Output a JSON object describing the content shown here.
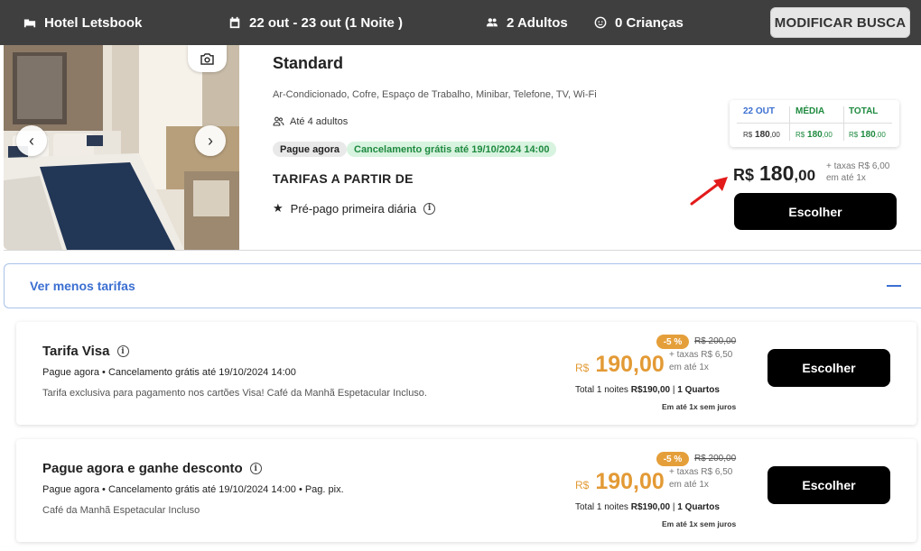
{
  "header": {
    "hotel_name": "Hotel Letsbook",
    "dates": "22 out - 23 out (1 Noite )",
    "adults": "2 Adultos",
    "children": "0 Crianças",
    "modify_button": "MODIFICAR BUSCA",
    "icons": {
      "hotel": "hotel-icon",
      "calendar": "calendar-icon",
      "adults": "people-icon",
      "children": "child-icon"
    }
  },
  "room": {
    "title": "Standard",
    "amenities": "Ar-Condicionado, Cofre, Espaço de Trabalho, Minibar, Telefone, TV, Wi-Fi",
    "capacity": "Até 4 adultos",
    "badge_payment": "Pague agora",
    "badge_cancel": "Cancelamento grátis até 19/10/2024 14:00",
    "rates_from": "TARIFAS A PARTIR DE",
    "prepaid_note": "Pré-pago primeira diária",
    "price_table": {
      "headers": [
        "22 OUT",
        "MÉDIA",
        "TOTAL"
      ],
      "values": [
        {
          "cur": "R$",
          "amount": "180",
          "dec": ",00"
        },
        {
          "cur": "R$",
          "amount": "180",
          "dec": ",00"
        },
        {
          "cur": "R$",
          "amount": "180",
          "dec": ",00"
        }
      ]
    },
    "price": {
      "currency": "R$",
      "integer": "180",
      "decimals": ",00"
    },
    "taxes": "+ taxas R$ 6,00",
    "installments": "em até 1x",
    "choose_button": "Escolher"
  },
  "less_rates_label": "Ver menos tarifas",
  "rates": [
    {
      "title": "Tarifa Visa",
      "subtitle": "Pague agora • Cancelamento grátis até 19/10/2024 14:00",
      "description": "Tarifa exclusiva para pagamento nos cartões Visa! Café da Manhã Espetacular Incluso.",
      "discount": "-5 %",
      "old_price": "R$ 200,00",
      "currency": "R$",
      "price": "190,00",
      "taxes": "+ taxas R$ 6,50",
      "installments": "em até 1x",
      "total_prefix": "Total 1 noites ",
      "total_amount": "R$190,00",
      "total_sep": " | ",
      "rooms": "1 Quartos",
      "no_interest": "Em até 1x sem juros",
      "choose_button": "Escolher"
    },
    {
      "title": "Pague agora e ganhe desconto",
      "subtitle": "Pague agora • Cancelamento grátis até 19/10/2024 14:00 • Pag. pix.",
      "description": "Café da Manhã Espetacular Incluso",
      "discount": "-5 %",
      "old_price": "R$ 200,00",
      "currency": "R$",
      "price": "190,00",
      "taxes": "+ taxas R$ 6,50",
      "installments": "em até 1x",
      "total_prefix": "Total 1 noites ",
      "total_amount": "R$190,00",
      "total_sep": " | ",
      "rooms": "1 Quartos",
      "no_interest": "Em até 1x sem juros",
      "choose_button": "Escolher"
    }
  ],
  "colors": {
    "topbar": "#3f3f3f",
    "accent_blue": "#3b6fd1",
    "price_orange": "#e39a35",
    "discount_orange": "#e59f3a",
    "green": "#1e8a3f",
    "arrow_red": "#e31b1b"
  }
}
